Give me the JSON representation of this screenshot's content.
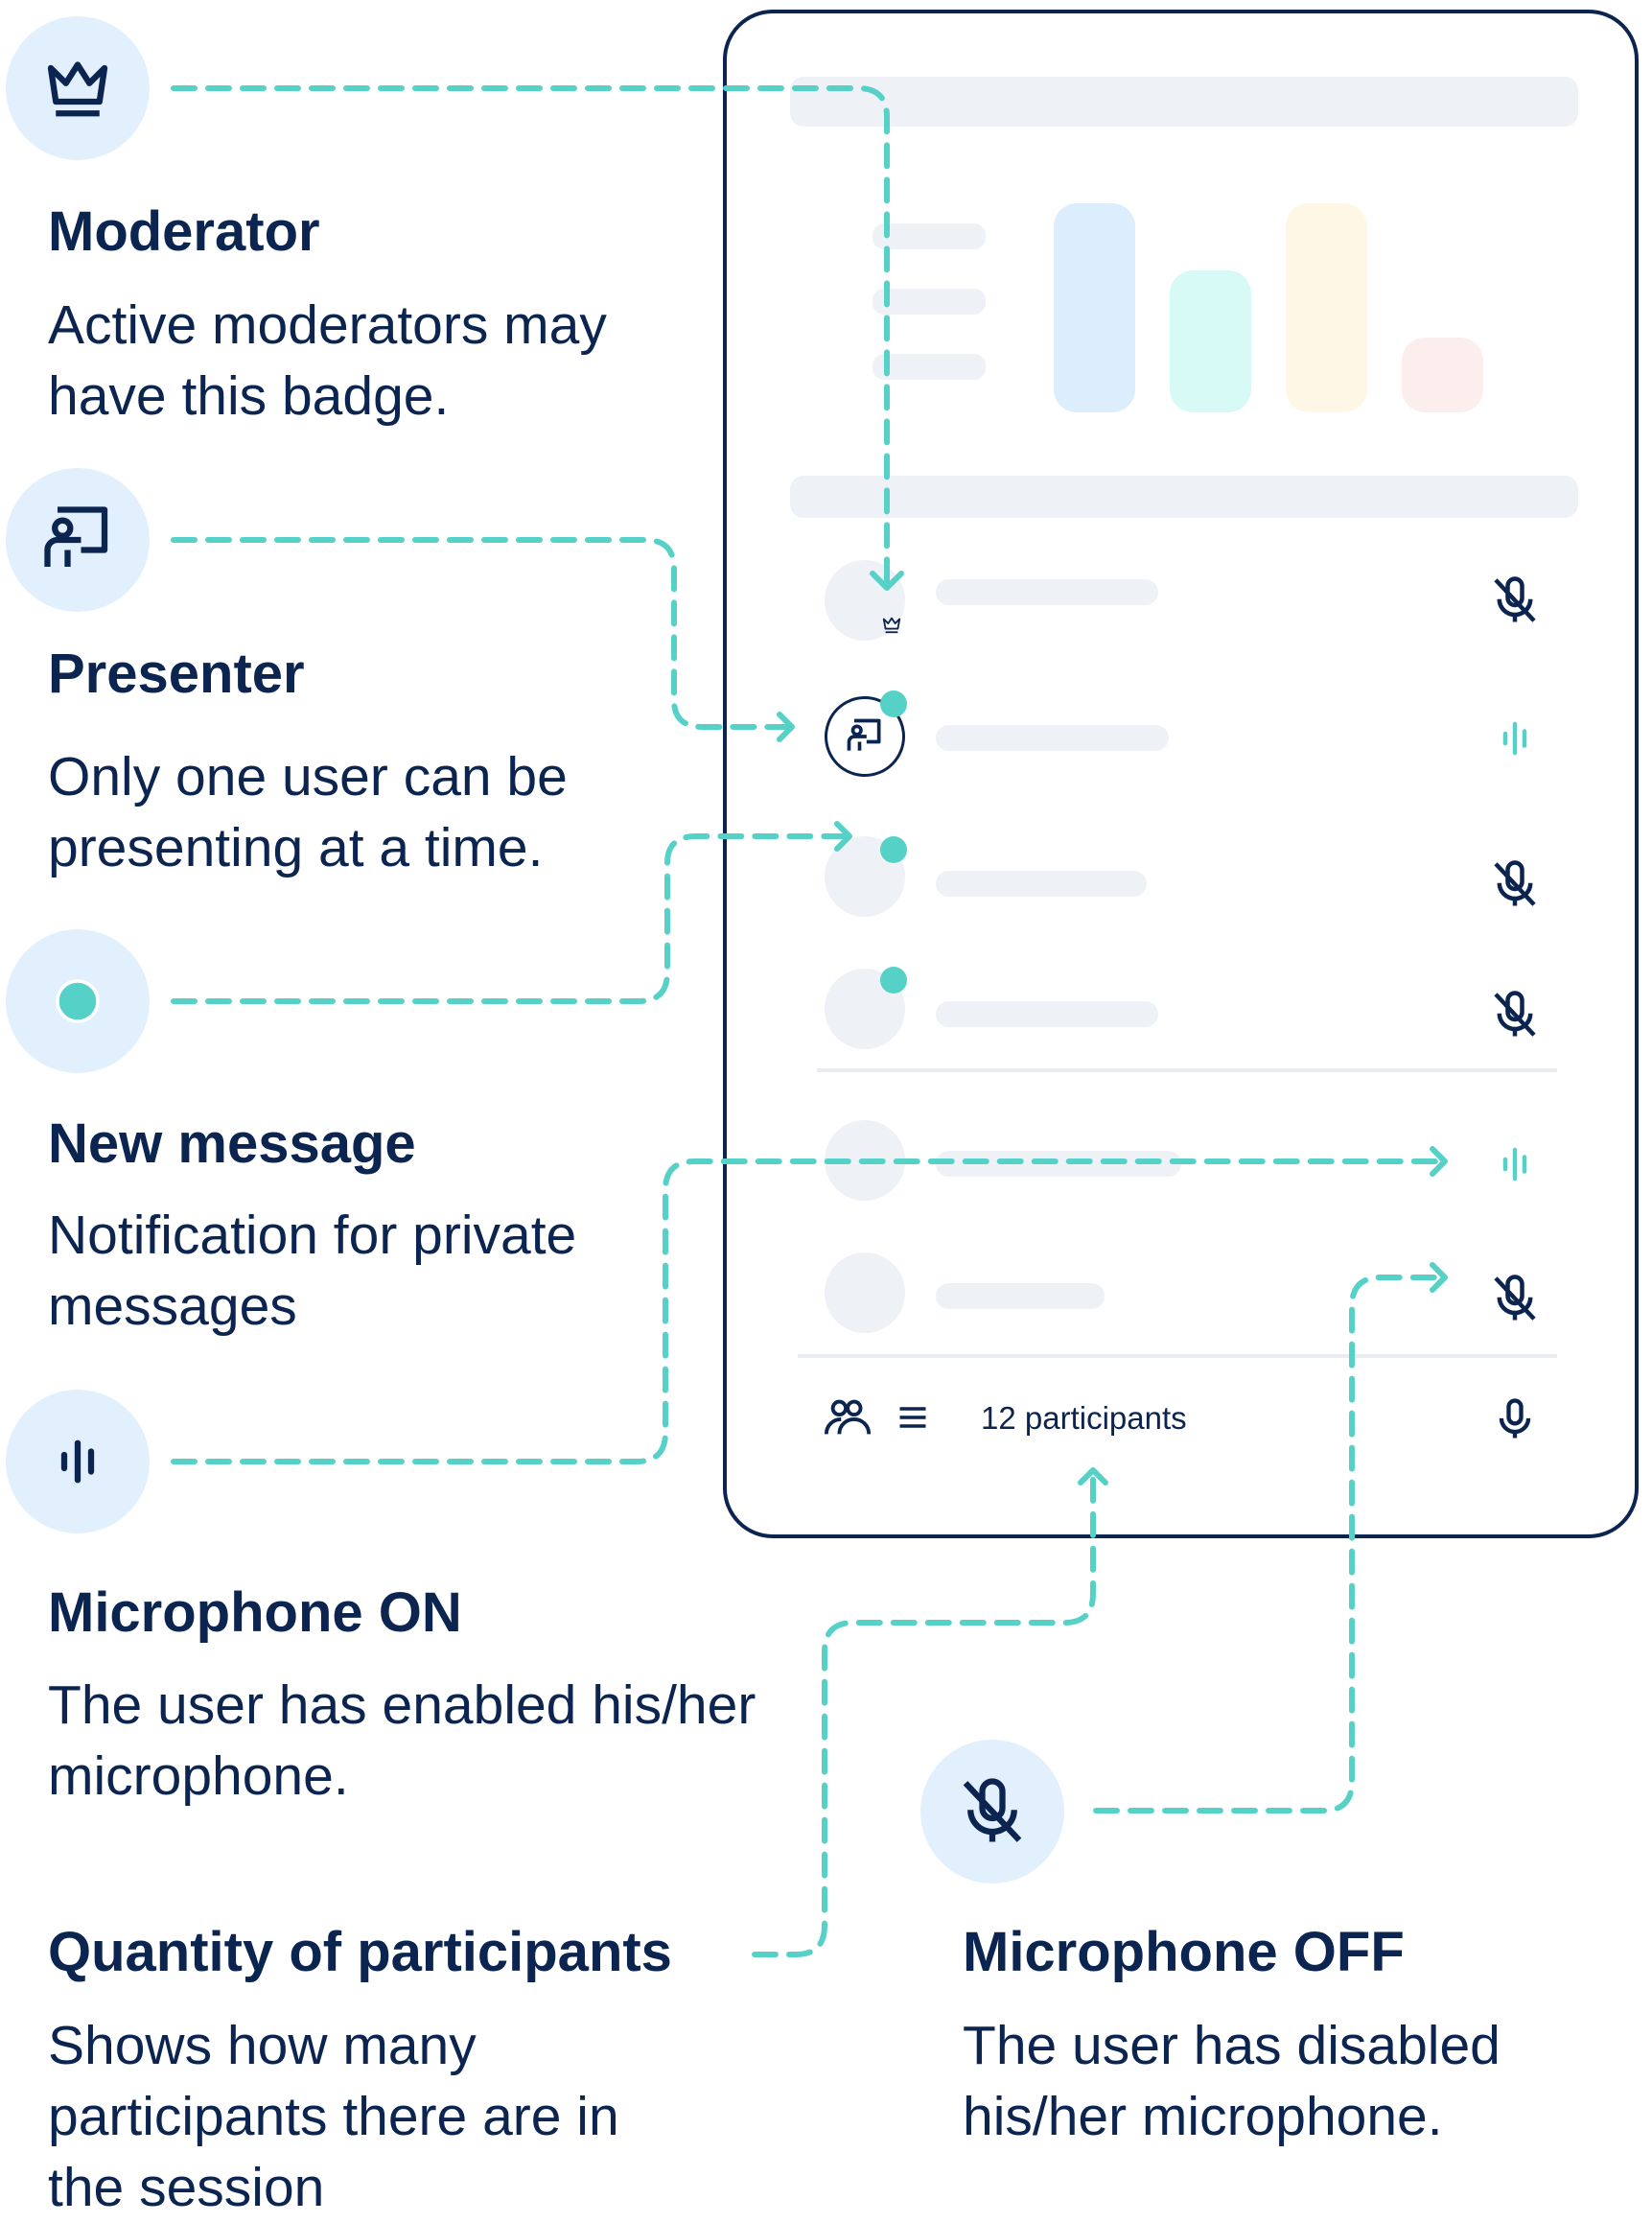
{
  "colors": {
    "navy": "#0b2450",
    "teal": "#56d1c7",
    "badge_bg": "#e1f0fc",
    "placeholder": "#eef1f6"
  },
  "legend": {
    "moderator": {
      "icon": "crown-icon",
      "title": "Moderator",
      "description": "Active moderators may have this badge."
    },
    "presenter": {
      "icon": "presenter-icon",
      "title": "Presenter",
      "description": "Only one user can be presenting at a time."
    },
    "new_message": {
      "icon": "dot-icon",
      "title": "New message",
      "description": "Notification for private messages"
    },
    "mic_on": {
      "icon": "audio-wave-icon",
      "title": "Microphone ON",
      "description": "The user has enabled his/her microphone."
    },
    "participants": {
      "title": "Quantity of participants",
      "description": "Shows how many participants there are in the session"
    },
    "mic_off": {
      "icon": "mic-off-icon",
      "title": "Microphone OFF",
      "description": "The user has disabled his/her microphone."
    }
  },
  "panel": {
    "participants_label": "12 participants",
    "rows": [
      {
        "badge": "crown-icon",
        "mic": "mic-off-icon",
        "new_message": false
      },
      {
        "badge": "presenter-icon",
        "mic": "audio-wave-icon",
        "new_message": true
      },
      {
        "badge": "none",
        "mic": "mic-off-icon",
        "new_message": true
      },
      {
        "badge": "none",
        "mic": "mic-off-icon",
        "new_message": true
      },
      {
        "badge": "none",
        "mic": "audio-wave-icon",
        "new_message": false
      },
      {
        "badge": "none",
        "mic": "mic-off-icon",
        "new_message": false
      }
    ],
    "footer_icons": [
      "participants-icon",
      "menu-icon",
      "microphone-icon"
    ]
  }
}
